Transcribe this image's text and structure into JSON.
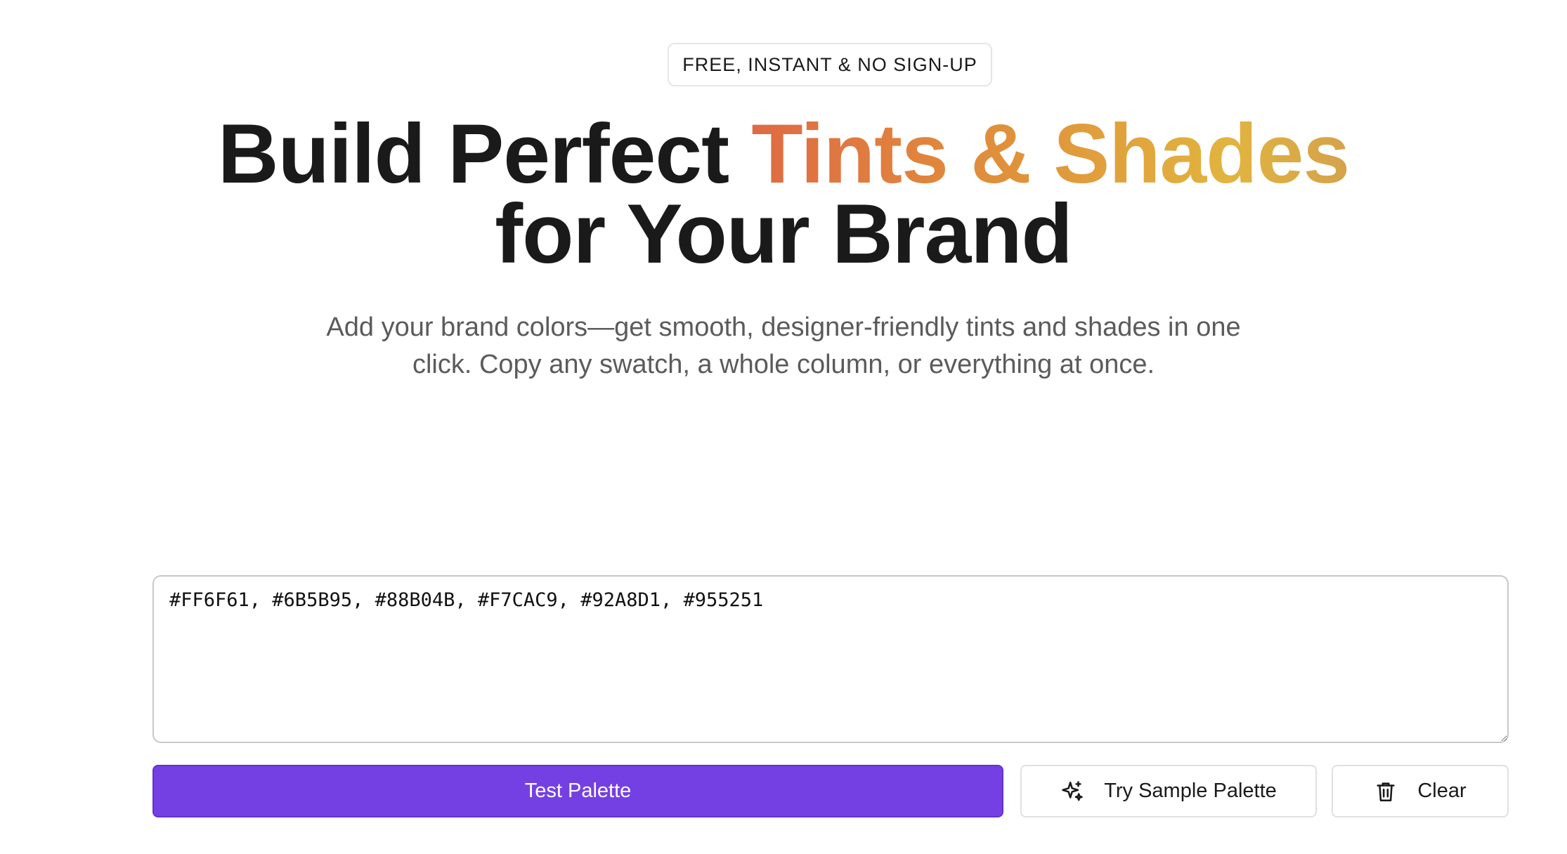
{
  "badge": {
    "label": "FREE, INSTANT & NO SIGN-UP"
  },
  "hero": {
    "title_plain": "Build Perfect ",
    "title_highlight": "Tints & Shades",
    "title_line2": "for Your Brand",
    "subtitle_line1": "Add your brand colors—get smooth, designer-friendly tints and shades in one",
    "subtitle_line2": "click. Copy any swatch, a whole column, or everything at once."
  },
  "input": {
    "value": "#FF6F61, #6B5B95, #88B04B, #F7CAC9, #92A8D1, #955251"
  },
  "actions": {
    "test_label": "Test Palette",
    "sample_label": "Try Sample Palette",
    "sample_icon": "sparkles-icon",
    "clear_label": "Clear",
    "clear_icon": "trash-icon"
  },
  "colors": {
    "primary": "#7440E3",
    "gradient_start": "#DF6A43",
    "gradient_end": "#D4A24C"
  }
}
